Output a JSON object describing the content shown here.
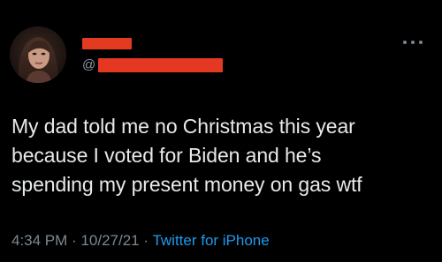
{
  "tweet": {
    "author": {
      "handle_prefix": "@"
    },
    "body_lines": [
      "My dad told me no Christmas this year",
      "because I voted for Biden and he’s",
      "spending my present money on gas wtf"
    ],
    "time": "4:34 PM",
    "separator": "·",
    "date": "10/27/21",
    "source": "Twitter for iPhone"
  },
  "colors": {
    "background": "#000000",
    "text": "#e7e9ea",
    "muted": "#7c8893",
    "link": "#1d9bf0",
    "redaction": "#e33a22"
  },
  "icons": {
    "more": "more-dots-icon",
    "avatar": "profile-avatar"
  }
}
